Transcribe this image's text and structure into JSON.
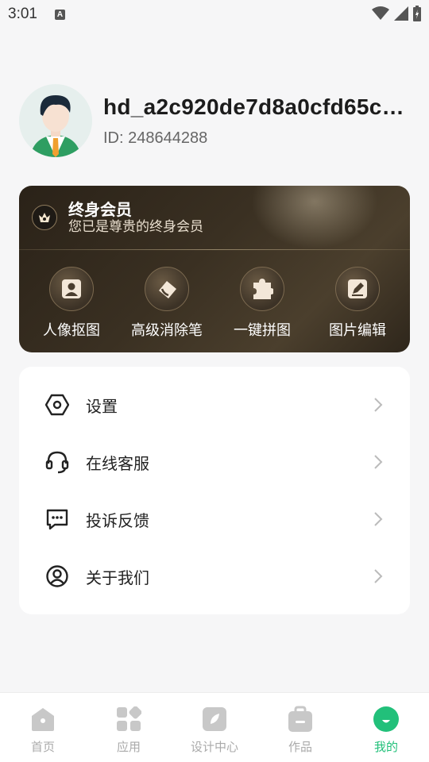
{
  "status_bar": {
    "time": "3:01",
    "notification_icon": "A"
  },
  "profile": {
    "username": "hd_a2c920de7d8a0cfd65c…",
    "user_id": "ID: 248644288"
  },
  "vip": {
    "title": "终身会员",
    "subtitle": "您已是尊贵的终身会员",
    "tools": [
      {
        "label": "人像抠图",
        "icon": "portrait-cutout-icon"
      },
      {
        "label": "高级消除笔",
        "icon": "eraser-icon"
      },
      {
        "label": "一键拼图",
        "icon": "puzzle-icon"
      },
      {
        "label": "图片编辑",
        "icon": "edit-image-icon"
      }
    ]
  },
  "menu": {
    "items": [
      {
        "label": "设置",
        "icon": "settings-hexagon-icon"
      },
      {
        "label": "在线客服",
        "icon": "headset-icon"
      },
      {
        "label": "投诉反馈",
        "icon": "message-dots-icon"
      },
      {
        "label": "关于我们",
        "icon": "user-circle-icon"
      }
    ]
  },
  "bottom_nav": {
    "items": [
      {
        "label": "首页",
        "icon": "home-icon"
      },
      {
        "label": "应用",
        "icon": "apps-grid-icon"
      },
      {
        "label": "设计中心",
        "icon": "design-leaf-icon"
      },
      {
        "label": "作品",
        "icon": "works-bag-icon"
      },
      {
        "label": "我的",
        "icon": "profile-icon",
        "active": true
      }
    ]
  },
  "colors": {
    "accent": "#22c07a",
    "nav_inactive": "#aaaaaa",
    "vip_bg": "#3a3022"
  }
}
